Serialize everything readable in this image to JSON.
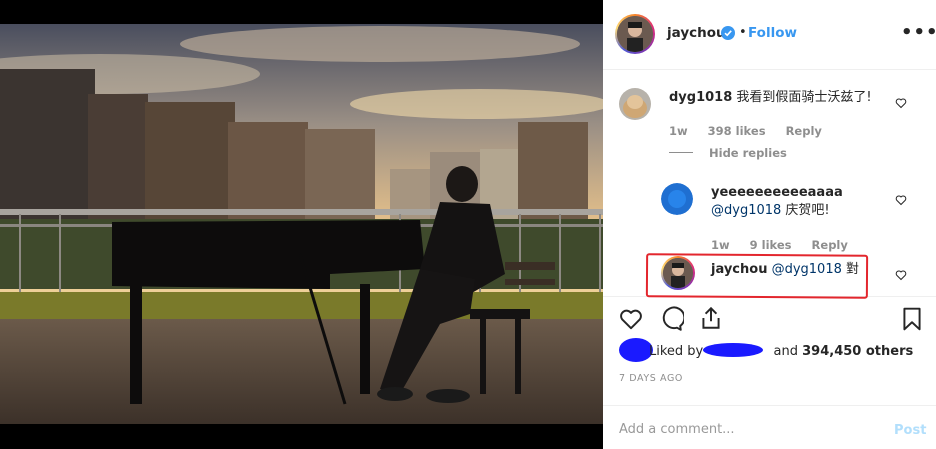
{
  "post": {
    "author": "jaychou",
    "follow_label": "Follow",
    "dot": "•",
    "more_label": "•••"
  },
  "comments": [
    {
      "user": "dyg1018",
      "text": "我看到假面骑士沃兹了!",
      "time": "1w",
      "likes": "398 likes",
      "reply": "Reply",
      "hide_replies": "Hide replies"
    },
    {
      "user": "yeeeeeeeeeeaaaa",
      "mention": "@dyg1018",
      "text": " 庆贺吧!",
      "time": "1w",
      "likes": "9 likes",
      "reply": "Reply"
    },
    {
      "user": "jaychou",
      "mention": "@dyg1018",
      "text": " 對"
    }
  ],
  "stats": {
    "liked_by_prefix": "Liked by",
    "and_text": "and",
    "others_count": "394,450 others",
    "date": "7 DAYS AGO"
  },
  "comment_box": {
    "placeholder": "Add a comment...",
    "post_label": "Post"
  },
  "icons": [
    "heart-icon",
    "comment-icon",
    "share-icon",
    "bookmark-icon",
    "verified-icon",
    "more-icon"
  ],
  "colors": {
    "link_blue": "#3897f0",
    "mention_blue": "#003569",
    "annotation_red": "#e3262d",
    "redaction_blue": "#1a1aff"
  }
}
